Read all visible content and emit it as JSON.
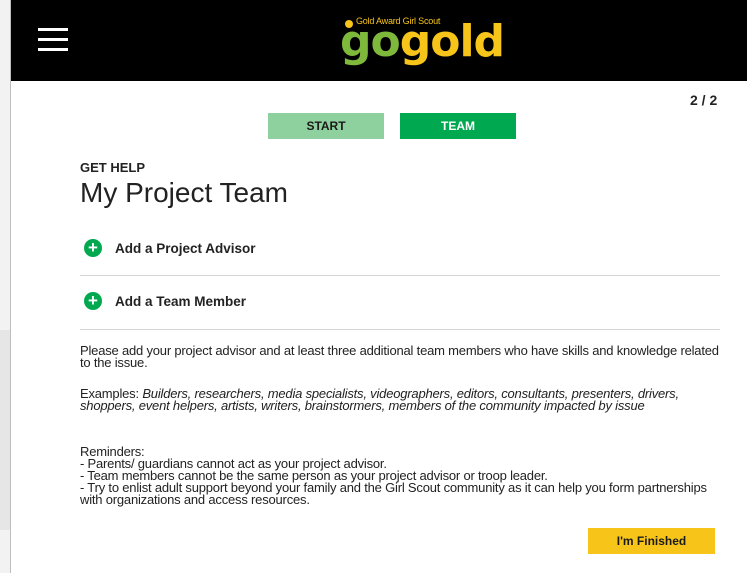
{
  "header": {
    "logo_tagline": "Gold Award Girl Scout",
    "logo_go": "go",
    "logo_gold": "gold"
  },
  "progress": {
    "counter": "2 / 2"
  },
  "steps": [
    {
      "label": "START"
    },
    {
      "label": "TEAM"
    }
  ],
  "section": {
    "eyebrow": "GET HELP",
    "title": "My Project Team"
  },
  "actions": {
    "add_advisor": "Add a Project Advisor",
    "add_member": "Add a Team Member"
  },
  "content": {
    "intro": "Please add your project advisor and at least three additional team members who have skills and knowledge related to the issue.",
    "examples_label": "Examples: ",
    "examples": "Builders, researchers, media specialists, videographers, editors, consultants, presenters, drivers, shoppers, event helpers, artists, writers, brainstormers, members of the community impacted by issue",
    "reminders_label": "Reminders:",
    "reminders": [
      "- Parents/ guardians cannot act as your project advisor.",
      "- Team members cannot be the same person as your project advisor or troop leader.",
      "- Try to enlist adult support beyond your family and the Girl Scout community as it can help you form partnerships with organizations and access resources."
    ]
  },
  "footer": {
    "finish_label": "I'm Finished"
  },
  "colors": {
    "header_bg": "#000000",
    "accent_green": "#00a94f",
    "light_green": "#8fd19e",
    "gold": "#f7c51a"
  },
  "icons": {
    "menu": "hamburger-menu-icon",
    "add": "plus-circle-icon"
  }
}
